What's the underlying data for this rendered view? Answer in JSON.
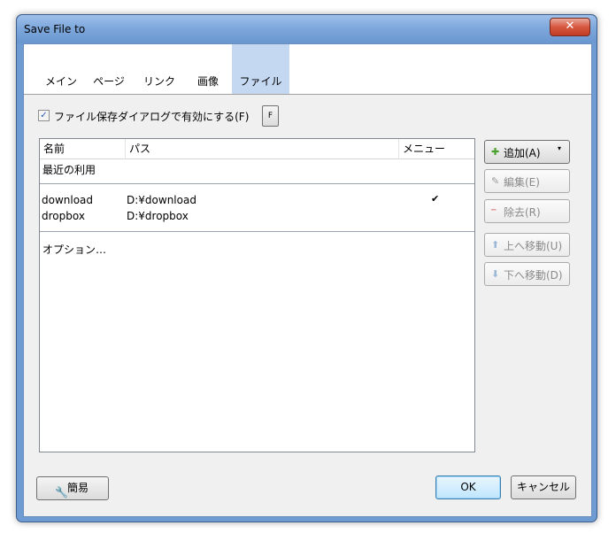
{
  "window": {
    "title": "Save File to",
    "close_glyph": "✕"
  },
  "tabs": [
    {
      "label": "メイン"
    },
    {
      "label": "ページ"
    },
    {
      "label": "リンク"
    },
    {
      "label": "画像"
    },
    {
      "label": "ファイル",
      "active": true
    }
  ],
  "option": {
    "checkbox_label": "ファイル保存ダイアログで有効にする(F)",
    "checked": true,
    "check_glyph": "✓",
    "f_button_label": "F"
  },
  "list": {
    "columns": [
      "名前",
      "パス",
      "メニュー"
    ],
    "groups": {
      "recent": "最近の利用",
      "options": "オプション…"
    },
    "rows": [
      {
        "name": "download",
        "path": "D:¥download",
        "menu": "✔"
      },
      {
        "name": "dropbox",
        "path": "D:¥dropbox",
        "menu": ""
      }
    ]
  },
  "side_buttons": {
    "add": {
      "label": "追加(A)",
      "icon": "plus-icon",
      "glyph": "✚",
      "dropdown_glyph": "▾"
    },
    "edit": {
      "label": "編集(E)",
      "icon": "pencil-icon",
      "glyph": "✎"
    },
    "remove": {
      "label": "除去(R)",
      "icon": "minus-icon",
      "glyph": "━"
    },
    "move_up": {
      "label": "上へ移動(U)",
      "icon": "arrow-up-icon",
      "glyph": "⬆"
    },
    "move_down": {
      "label": "下へ移動(D)",
      "icon": "arrow-down-icon",
      "glyph": "⬇"
    }
  },
  "footer": {
    "simple_label": "簡易",
    "simple_icon": "wrench-icon",
    "simple_glyph": "🔧",
    "ok_label": "OK",
    "cancel_label": "キャンセル"
  },
  "colors": {
    "accent": "#c5d8f2",
    "titlebar": "#7ea8dc",
    "close": "#d7573f"
  }
}
